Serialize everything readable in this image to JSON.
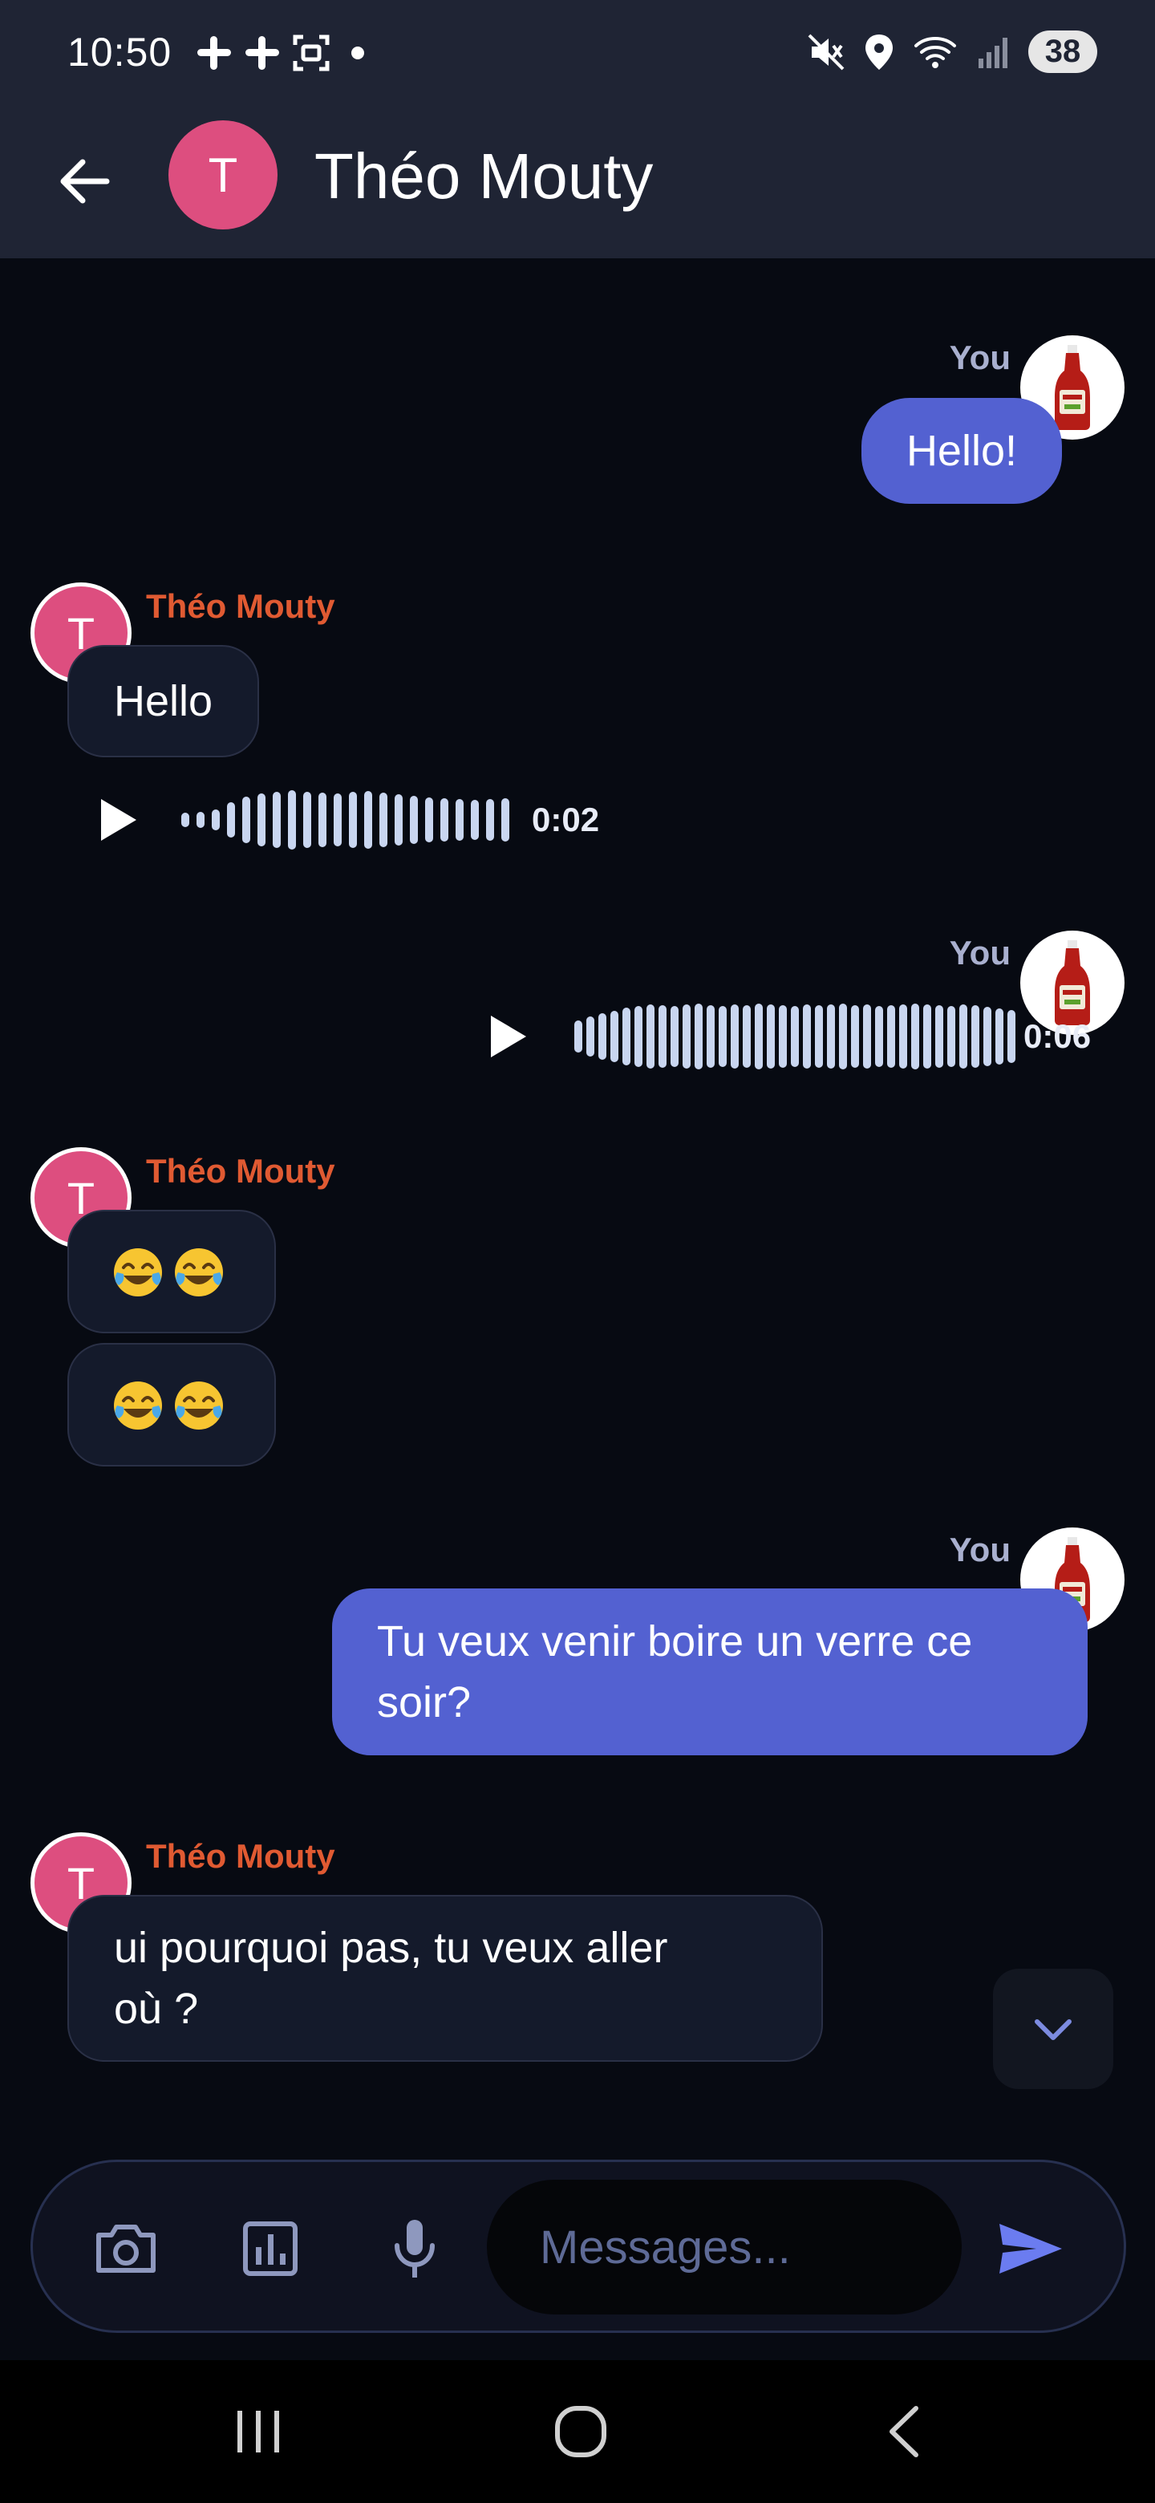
{
  "status_bar": {
    "time": "10:50",
    "battery": "38",
    "left_icons": [
      "slack-icon",
      "slack-icon",
      "screenshot-icon",
      "dot-icon"
    ],
    "right_icons": [
      "mute-icon",
      "location-icon",
      "wifi-icon",
      "signal-icon"
    ]
  },
  "header": {
    "avatar_initial": "T",
    "title": "Théo Mouty"
  },
  "messages": [
    {
      "sender": "You",
      "type": "text",
      "text": "Hello!"
    },
    {
      "sender": "Théo Mouty",
      "type": "text",
      "text": "Hello"
    },
    {
      "sender": "Théo Mouty",
      "type": "audio",
      "duration": "0:02"
    },
    {
      "sender": "You",
      "type": "audio",
      "duration": "0:06"
    },
    {
      "sender": "Théo Mouty",
      "type": "emoji",
      "text": "😂😂"
    },
    {
      "sender": "Théo Mouty",
      "type": "emoji",
      "text": "😂😂"
    },
    {
      "sender": "You",
      "type": "text",
      "lines": [
        "Tu veux venir boire un verre ce",
        "soir?"
      ]
    },
    {
      "sender": "Théo Mouty",
      "type": "text",
      "lines": [
        "ui pourquoi pas, tu veux aller",
        "où ?"
      ]
    }
  ],
  "theo_avatar_initial": "T",
  "composer": {
    "placeholder": "Messages...",
    "icons": [
      "camera-icon",
      "poll-icon",
      "microphone-icon",
      "send-icon"
    ]
  },
  "colors": {
    "background": "#070a12",
    "header": "#1f2434",
    "you_bubble": "#5361d1",
    "theo_bubble": "#141a2b",
    "theo_name": "#e05a32",
    "avatar": "#dd4e7f",
    "online": "#4ecb71",
    "send": "#6b7cf0"
  }
}
